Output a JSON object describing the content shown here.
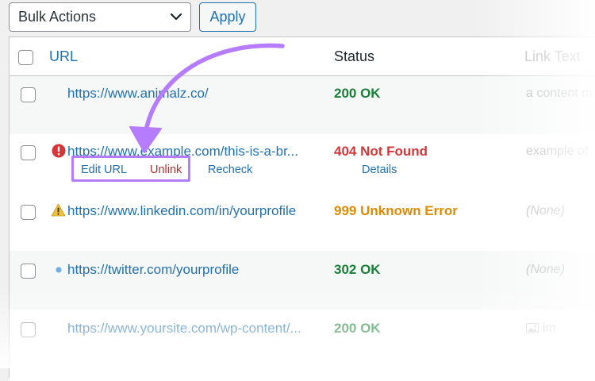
{
  "toolbar": {
    "bulk_actions": {
      "selected": "Bulk Actions"
    },
    "apply_label": "Apply"
  },
  "table": {
    "headers": {
      "url": "URL",
      "status": "Status",
      "link_text": "Link Text"
    },
    "rows": [
      {
        "icon": "none",
        "url": "https://www.animalz.co/",
        "status": "200 OK",
        "status_color": "#1a7f37",
        "link_text": "a content m"
      },
      {
        "icon": "error-icon",
        "url": "https://www.example.com/this-is-a-br...",
        "status": "404 Not Found",
        "status_color": "#d63638",
        "link_text": "example of",
        "row_actions": {
          "edit_url": "Edit URL",
          "unlink": "Unlink",
          "recheck": "Recheck",
          "details": "Details"
        }
      },
      {
        "icon": "warning-icon",
        "url": "https://www.linkedin.com/in/yourprofile",
        "status": "999 Unknown Error",
        "status_color": "#e08a00",
        "link_text": "(None)"
      },
      {
        "icon": "dot-icon",
        "url": "https://twitter.com/yourprofile",
        "status": "302 OK",
        "status_color": "#1a7f37",
        "link_text": "(None)"
      },
      {
        "icon": "none",
        "url": "https://www.yoursite.com/wp-content/...",
        "status": "200 OK",
        "status_color": "#1a7f37",
        "link_text": "im"
      }
    ]
  },
  "colors": {
    "link": "#2271b1",
    "highlight": "#b57cff",
    "annotation_arrow": "#b57cff",
    "unlink": "#b32d2e"
  }
}
